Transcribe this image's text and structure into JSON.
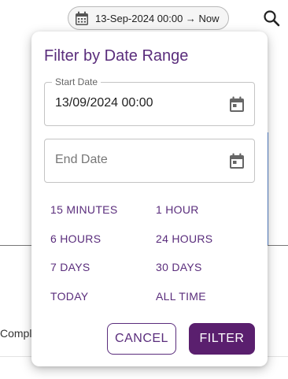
{
  "header": {
    "date_range_chip": {
      "label": "13-Sep-2024 00:00 → Now",
      "icon": "calendar-icon"
    },
    "search_icon": "search-icon"
  },
  "background": {
    "partial_text": "Compl"
  },
  "filter_dialog": {
    "title": "Filter by Date Range",
    "start_date": {
      "label": "Start Date",
      "value": "13/09/2024 00:00",
      "icon": "calendar-icon"
    },
    "end_date": {
      "placeholder": "End Date",
      "value": "",
      "icon": "calendar-icon"
    },
    "presets": [
      "15 MINUTES",
      "1 HOUR",
      "6 HOURS",
      "24 HOURS",
      "7 DAYS",
      "30 DAYS",
      "TODAY",
      "ALL TIME"
    ],
    "cancel_label": "CANCEL",
    "filter_label": "FILTER"
  },
  "colors": {
    "accent": "#5a2d7c",
    "filter_button_bg": "#5a1f6e",
    "chip_border": "#b8b8b8"
  }
}
